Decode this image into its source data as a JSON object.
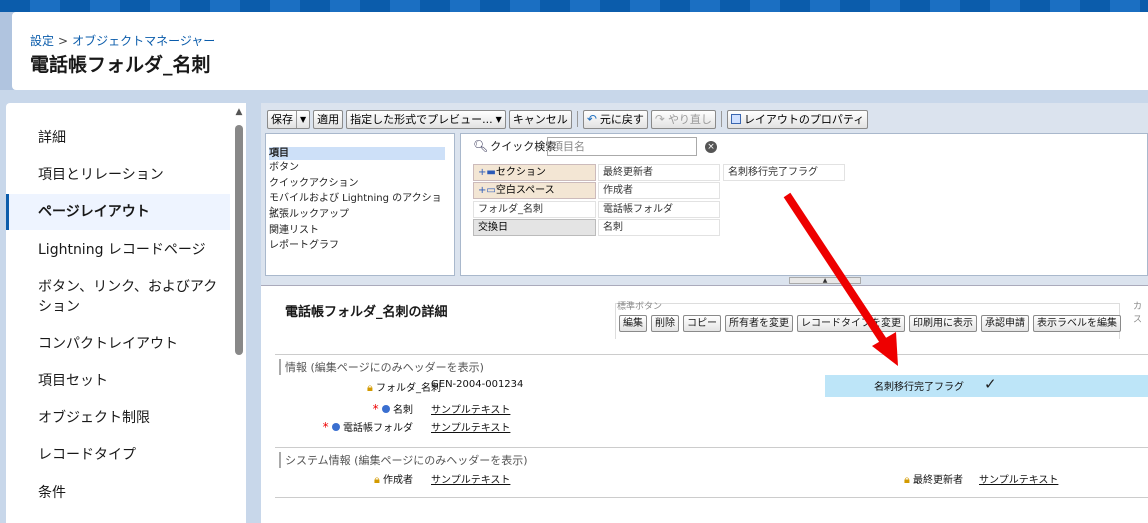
{
  "header": {
    "breadcrumb": {
      "parent": "設定",
      "separator": ">",
      "current": "オブジェクトマネージャー"
    },
    "title": "電話帳フォルダ_名刺"
  },
  "sidebar": {
    "items": [
      {
        "label": "詳細",
        "active": false
      },
      {
        "label": "項目とリレーション",
        "active": false
      },
      {
        "label": "ページレイアウト",
        "active": true
      },
      {
        "label": "Lightning レコードページ",
        "active": false
      },
      {
        "label": "ボタン、リンク、およびアク",
        "label2": "ション",
        "active": false
      },
      {
        "label": "コンパクトレイアウト",
        "active": false
      },
      {
        "label": "項目セット",
        "active": false
      },
      {
        "label": "オブジェクト制限",
        "active": false
      },
      {
        "label": "レコードタイプ",
        "active": false
      },
      {
        "label": "条件",
        "active": false
      }
    ]
  },
  "toolbar": {
    "save": "保存",
    "apply": "適用",
    "preview": "指定した形式でプレビュー...",
    "cancel": "キャンセル",
    "undo": "元に戻す",
    "redo": "やり直し",
    "layout_props": "レイアウトのプロパティ"
  },
  "palette": {
    "categories": [
      "項目",
      "ボタン",
      "クイックアクション",
      "モバイルおよび Lightning のアクション",
      "拡張ルックアップ",
      "関連リスト",
      "レポートグラフ"
    ],
    "quick_search_label": "クイック検索",
    "quick_search_placeholder": "項目名",
    "fields": {
      "col1": [
        "セクション",
        "空白スペース",
        "フォルダ_名刺",
        "交換日"
      ],
      "col2": [
        "最終更新者",
        "作成者",
        "電話帳フォルダ",
        "名刺"
      ],
      "col3": [
        "名刺移行完了フラグ"
      ]
    }
  },
  "detail": {
    "title": "電話帳フォルダ_名刺の詳細",
    "standard_buttons_label": "標準ボタン",
    "custom_buttons_label": "カス",
    "buttons": [
      "編集",
      "削除",
      "コピー",
      "所有者を変更",
      "レコードタイプを変更",
      "印刷用に表示",
      "承認申請",
      "表示ラベルを編集"
    ],
    "section1": {
      "header": "情報 (編集ページにのみヘッダーを表示)",
      "fields": [
        {
          "label": "フォルダ_名刺",
          "value": "GEN-2004-001234"
        },
        {
          "label": "名刺",
          "value": "サンプルテキスト"
        },
        {
          "label": "電話帳フォルダ",
          "value": "サンプルテキスト"
        }
      ],
      "highlight_field": {
        "label": "名刺移行完了フラグ",
        "value": "✓"
      }
    },
    "section2": {
      "header": "システム情報 (編集ページにのみヘッダーを表示)",
      "fields": [
        {
          "label": "作成者",
          "value": "サンプルテキスト"
        },
        {
          "label": "最終更新者",
          "value": "サンプルテキスト"
        }
      ]
    }
  },
  "colors": {
    "accent": "#0b5cab",
    "arrow": "#ee0000",
    "highlight": "#bde5f8"
  }
}
